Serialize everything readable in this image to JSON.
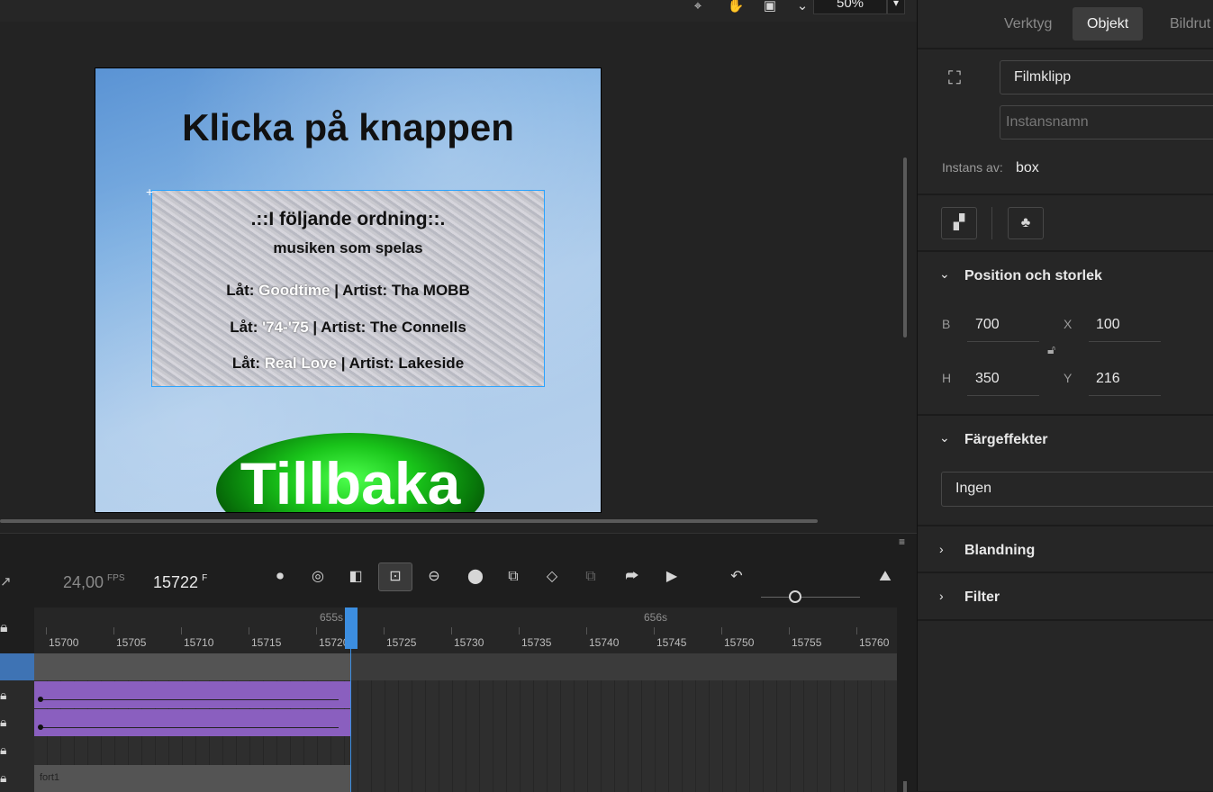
{
  "toolbar": {
    "zoom_value": "50%",
    "icons": [
      "snap-icon",
      "hand-icon",
      "clip-icon",
      "chevron-down-icon"
    ]
  },
  "canvas": {
    "title": "Klicka på knappen",
    "box_heading": ".::I följande ordning::.",
    "box_subheading": "musiken som spelas",
    "songs": [
      {
        "prefix": "Låt: ",
        "song": "Goodtime",
        "suffix": " | Artist: Tha MOBB"
      },
      {
        "prefix": "Låt: ",
        "song": "'74-'75",
        "suffix": " | Artist: The Connells"
      },
      {
        "prefix": "Låt: ",
        "song": "Real Love",
        "suffix": " | Artist: Lakeside"
      }
    ],
    "back_button_label": "Tillbaka"
  },
  "timeline": {
    "fps_value": "24,00",
    "fps_unit": "FPS",
    "frame_value": "15722",
    "frame_unit": "F",
    "second_labels": [
      "655s",
      "656s"
    ],
    "tick_labels": [
      "15700",
      "15705",
      "15710",
      "15715",
      "15720",
      "15725",
      "15730",
      "15735",
      "15740",
      "15745",
      "15750",
      "15755",
      "15760"
    ],
    "layer_label": "fort1"
  },
  "panel": {
    "tabs": [
      "Verktyg",
      "Objekt",
      "Bildrut"
    ],
    "symbol_type": "Filmklipp",
    "instance_placeholder": "Instansnamn",
    "instance_of_label": "Instans av:",
    "instance_of_value": "box",
    "position_section": "Position och storlek",
    "b_label": "B",
    "b_value": "700",
    "h_label": "H",
    "h_value": "350",
    "x_label": "X",
    "x_value": "100",
    "y_label": "Y",
    "y_value": "216",
    "color_section": "Färgeffekter",
    "color_value": "Ingen",
    "blend_section": "Blandning",
    "filter_section": "Filter"
  },
  "colors": {
    "accent": "#3c8ee0",
    "tween_layer": "#8a5fbf",
    "selection_border": "#29a3ff",
    "button_green": "#19c41a"
  }
}
